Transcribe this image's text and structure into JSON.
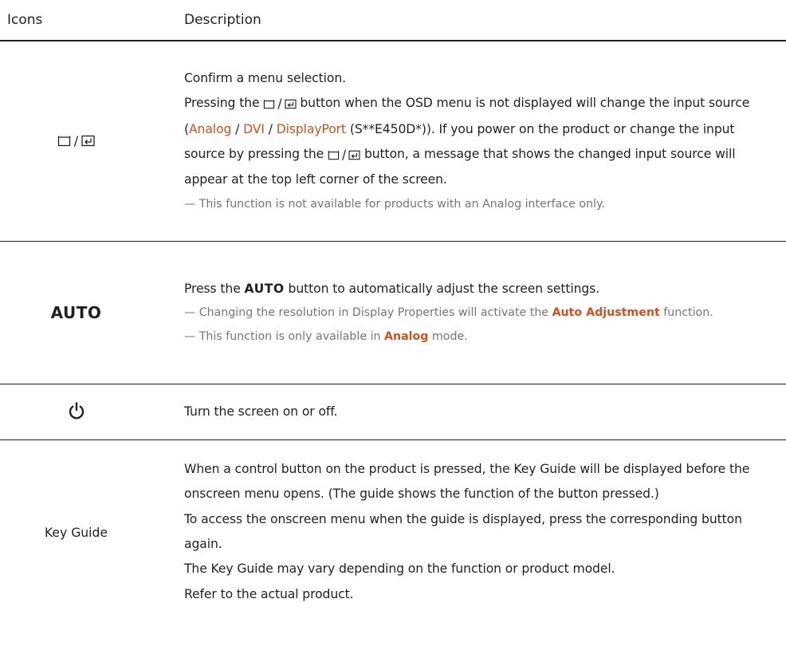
{
  "headers": {
    "icons": "Icons",
    "description": "Description"
  },
  "row_source": {
    "icon_name": "source-enter-icon",
    "slash": "/",
    "line1": "Confirm a menu selection.",
    "p2_a": "Pressing the ",
    "p2_b": " button when the OSD menu is not displayed will change the input source (",
    "analog": "Analog",
    "sep1": " / ",
    "dvi": "DVI",
    "sep2": " / ",
    "displayport": "DisplayPort",
    "p2_c": " (S**E450D*)). If you power on the product or change the input source by pressing the ",
    "p2_d": " button, a message that shows the changed input source will appear at the top left corner of the screen.",
    "note": "— This function is not available for products with an Analog interface only."
  },
  "row_auto": {
    "icon_label": "AUTO",
    "l_a": "Press the ",
    "l_auto": "AUTO",
    "l_b": " button to automatically adjust the screen settings.",
    "note1_a": "— Changing the resolution in Display Properties will activate the ",
    "note1_hl": "Auto Adjustment",
    "note1_b": " function.",
    "note2_a": "— This function is only available in ",
    "note2_hl": "Analog",
    "note2_b": " mode."
  },
  "row_power": {
    "icon_name": "power-icon",
    "line": "Turn the screen on or off."
  },
  "row_key_guide": {
    "icon_label": "Key Guide",
    "p1": "When a control button on the product is pressed, the Key Guide will be displayed before the onscreen menu opens. (The guide shows the function of the button pressed.)",
    "p2": "To access the onscreen menu when the guide is displayed, press the corresponding button again.",
    "p3": "The Key Guide may vary depending on the function or product model.",
    "p4": "Refer to the actual product."
  },
  "colors": {
    "highlight": "#d2501c",
    "note": "#757575",
    "text": "#231f20"
  }
}
